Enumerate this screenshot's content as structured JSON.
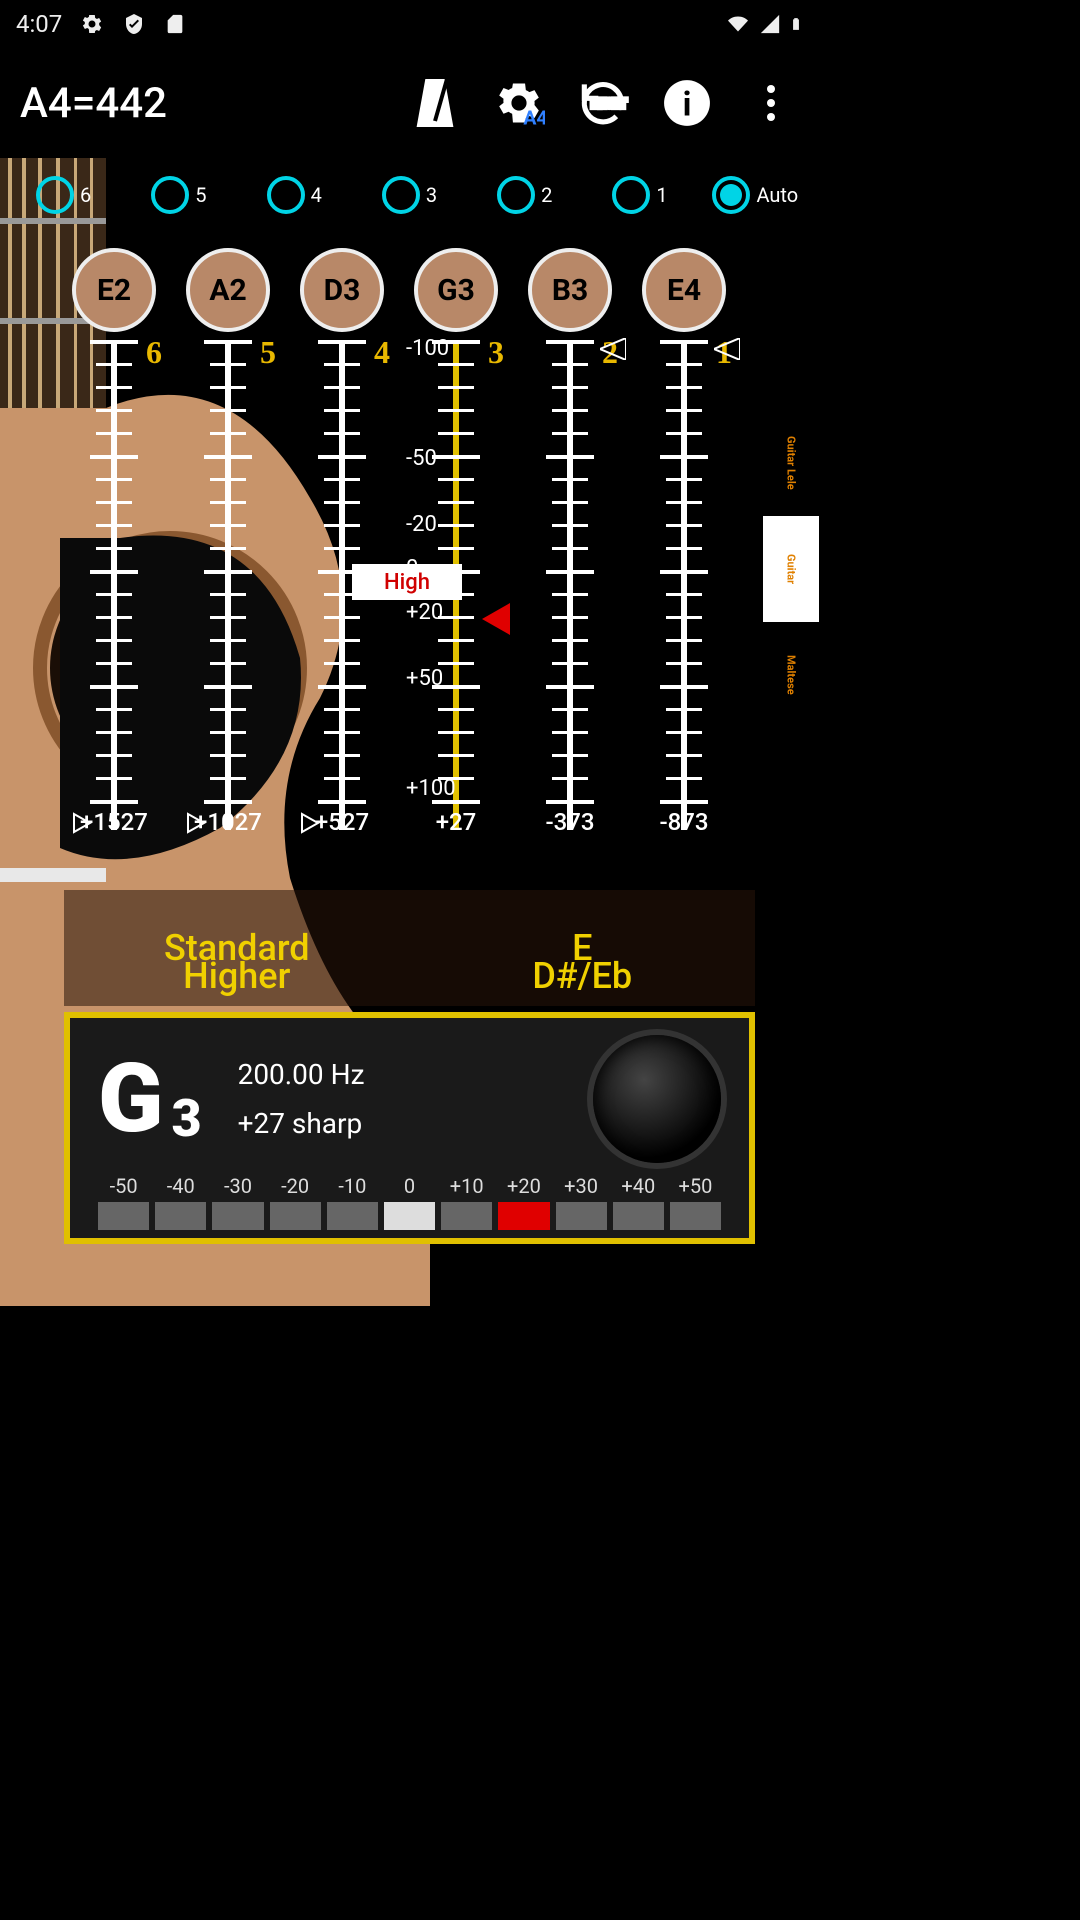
{
  "status": {
    "time": "4:07"
  },
  "appbar": {
    "title": "A4=442"
  },
  "radios": [
    {
      "label": "6",
      "selected": false
    },
    {
      "label": "5",
      "selected": false
    },
    {
      "label": "4",
      "selected": false
    },
    {
      "label": "3",
      "selected": false
    },
    {
      "label": "2",
      "selected": false
    },
    {
      "label": "1",
      "selected": false
    },
    {
      "label": "Auto",
      "selected": true
    }
  ],
  "strings": [
    {
      "note": "E2",
      "num": "6",
      "offset": "+1527",
      "play": true
    },
    {
      "note": "A2",
      "num": "5",
      "offset": "+1027",
      "play": true
    },
    {
      "note": "D3",
      "num": "4",
      "offset": "+527",
      "play": true
    },
    {
      "note": "G3",
      "num": "3",
      "offset": "+27",
      "play": false,
      "gold": true
    },
    {
      "note": "B3",
      "num": "2",
      "offset": "-373",
      "play": false
    },
    {
      "note": "E4",
      "num": "1",
      "offset": "-873",
      "play": false
    }
  ],
  "scale_labels": {
    "neg100": "-100",
    "neg50": "-50",
    "neg20": "-20",
    "zero": "0",
    "pos20": "+20",
    "pos50": "+50",
    "pos100": "+100"
  },
  "high_label": "High",
  "wheel": {
    "l1": "Standard",
    "r1": "E",
    "l2": "Higher",
    "r2": "D#/Eb"
  },
  "readout": {
    "note": "G",
    "octave": "3",
    "hz": "200.00 Hz",
    "cents": "+27 sharp"
  },
  "meter_labels": [
    "-50",
    "-40",
    "-30",
    "-20",
    "-10",
    "0",
    "+10",
    "+20",
    "+30",
    "+40",
    "+50"
  ],
  "meter_active_index": 7,
  "side_badges": [
    "Guitar Lele",
    "Guitar",
    "Maltese"
  ]
}
